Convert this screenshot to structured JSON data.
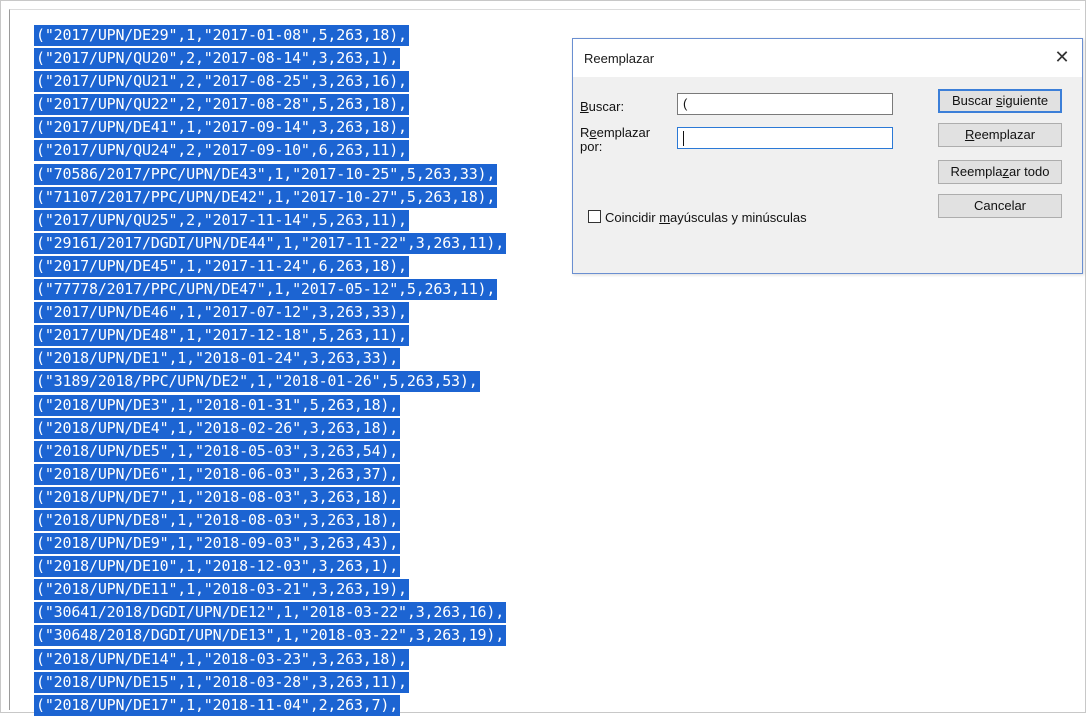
{
  "code_lines": [
    "(\"2017/UPN/DE29\",1,\"2017-01-08\",5,263,18),",
    "(\"2017/UPN/QU20\",2,\"2017-08-14\",3,263,1),",
    "(\"2017/UPN/QU21\",2,\"2017-08-25\",3,263,16),",
    "(\"2017/UPN/QU22\",2,\"2017-08-28\",5,263,18),",
    "(\"2017/UPN/DE41\",1,\"2017-09-14\",3,263,18),",
    "(\"2017/UPN/QU24\",2,\"2017-09-10\",6,263,11),",
    "(\"70586/2017/PPC/UPN/DE43\",1,\"2017-10-25\",5,263,33),",
    "(\"71107/2017/PPC/UPN/DE42\",1,\"2017-10-27\",5,263,18),",
    "(\"2017/UPN/QU25\",2,\"2017-11-14\",5,263,11),",
    "(\"29161/2017/DGDI/UPN/DE44\",1,\"2017-11-22\",3,263,11),",
    "(\"2017/UPN/DE45\",1,\"2017-11-24\",6,263,18),",
    "(\"77778/2017/PPC/UPN/DE47\",1,\"2017-05-12\",5,263,11),",
    "(\"2017/UPN/DE46\",1,\"2017-07-12\",3,263,33),",
    "(\"2017/UPN/DE48\",1,\"2017-12-18\",5,263,11),",
    "(\"2018/UPN/DE1\",1,\"2018-01-24\",3,263,33),",
    "(\"3189/2018/PPC/UPN/DE2\",1,\"2018-01-26\",5,263,53),",
    "(\"2018/UPN/DE3\",1,\"2018-01-31\",5,263,18),",
    "(\"2018/UPN/DE4\",1,\"2018-02-26\",3,263,18),",
    "(\"2018/UPN/DE5\",1,\"2018-05-03\",3,263,54),",
    "(\"2018/UPN/DE6\",1,\"2018-06-03\",3,263,37),",
    "(\"2018/UPN/DE7\",1,\"2018-08-03\",3,263,18),",
    "(\"2018/UPN/DE8\",1,\"2018-08-03\",3,263,18),",
    "(\"2018/UPN/DE9\",1,\"2018-09-03\",3,263,43),",
    "(\"2018/UPN/DE10\",1,\"2018-12-03\",3,263,1),",
    "(\"2018/UPN/DE11\",1,\"2018-03-21\",3,263,19),",
    "(\"30641/2018/DGDI/UPN/DE12\",1,\"2018-03-22\",3,263,16),",
    "(\"30648/2018/DGDI/UPN/DE13\",1,\"2018-03-22\",3,263,19),",
    "(\"2018/UPN/DE14\",1,\"2018-03-23\",3,263,18),",
    "(\"2018/UPN/DE15\",1,\"2018-03-28\",3,263,11),",
    "(\"2018/UPN/DE17\",1,\"2018-11-04\",2,263,7),"
  ],
  "dialog": {
    "title": "Reemplazar",
    "close_glyph": "✕",
    "find_label_u": "B",
    "find_label_rest": "uscar:",
    "find_value": "(",
    "replace_label_pre": "R",
    "replace_label_u": "e",
    "replace_label_rest": "emplazar",
    "replace_label_line2": "por:",
    "replace_value": "",
    "match_case_pre": "Coincidir ",
    "match_case_u": "m",
    "match_case_rest": "ayúsculas y minúsculas",
    "buttons": {
      "find_next_pre": "Buscar ",
      "find_next_u": "s",
      "find_next_rest": "iguiente",
      "replace_u": "R",
      "replace_rest": "eemplazar",
      "replace_all_pre": "Reempla",
      "replace_all_u": "z",
      "replace_all_rest": "ar todo",
      "cancel": "Cancelar"
    }
  },
  "colors": {
    "selection": "#1c64d2",
    "dialog_border": "#6a8fd1",
    "default_button_border": "#3c7fd8"
  }
}
